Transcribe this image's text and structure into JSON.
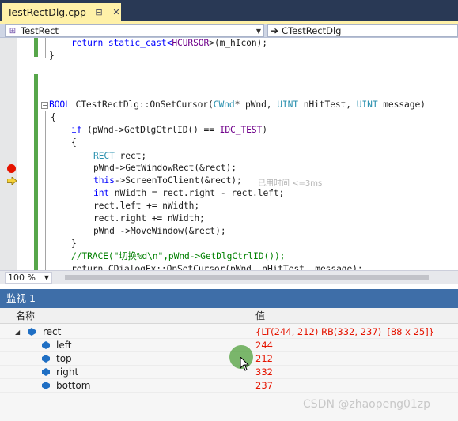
{
  "tab": {
    "label": "TestRectDlg.cpp",
    "pin_icon": "pin-icon",
    "close_icon": "close-icon"
  },
  "navbar": {
    "scope_value": "TestRect",
    "member_value": "CTestRectDlg"
  },
  "code": {
    "line1_a": "return static_cast<",
    "line1_mac": "HCURSOR",
    "line1_b": ">(m_hIcon);",
    "line2": "}",
    "sig_kw": "BOOL",
    "sig_a": " CTestRectDlg::OnSetCursor(",
    "sig_ty1": "CWnd",
    "sig_b": "* pWnd, ",
    "sig_ty2": "UINT",
    "sig_c": " nHitTest, ",
    "sig_ty3": "UINT",
    "sig_d": " message)",
    "open_brace": "{",
    "if_kw": "if",
    "if_a": " (pWnd->GetDlgCtrlID() == ",
    "if_mac": "IDC_TEST",
    "if_b": ")",
    "open_brace2": "{",
    "rect_ty": "RECT",
    "rect_decl": " rect;",
    "getwin": "pWnd->GetWindowRect(&rect);",
    "this_kw": "this",
    "screen": "->ScreenToClient(&rect);",
    "hint": "已用时间 <=3ms",
    "int_kw": "int",
    "width_decl": " nWidth = rect.right - rect.left;",
    "left_add": "rect.left += nWidth;",
    "right_add": "rect.right += nWidth;",
    "move": "pWnd ->MoveWindow(&rect);",
    "close_brace": "}",
    "comment": "//TRACE(\"切换%d\\n\",pWnd->GetDlgCtrlID());",
    "return_partial": "return CDialogEx::OnSetCursor(pWnd, nHitTest, message);"
  },
  "zoom": {
    "value": "100 %"
  },
  "watch": {
    "title": "监视 1",
    "col_name": "名称",
    "col_value": "值",
    "rows": [
      {
        "name": "rect",
        "value": "{LT(244, 212) RB(332, 237)  [88 x 25]}"
      },
      {
        "name": "left",
        "value": "244"
      },
      {
        "name": "top",
        "value": "212"
      },
      {
        "name": "right",
        "value": "332"
      },
      {
        "name": "bottom",
        "value": "237"
      }
    ]
  },
  "watermark": "CSDN @zhaopeng01zp",
  "colors": {
    "accent": "#3e6ea8",
    "tab": "#fff1a8",
    "breakpoint": "#e51400",
    "changed_value": "#e51400",
    "keyword": "#0000ff",
    "type": "#2b91af",
    "macro": "#6f008a",
    "comment": "#008000"
  }
}
